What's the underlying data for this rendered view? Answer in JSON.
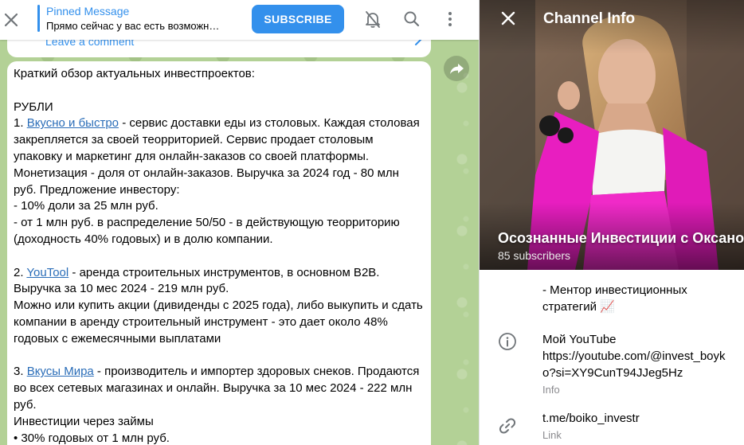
{
  "topbar": {
    "pinned_title": "Pinned Message",
    "pinned_text": "Прямо сейчас у вас есть возможн…",
    "subscribe_label": "SUBSCRIBE"
  },
  "comment": {
    "label": "Leave a comment"
  },
  "message": {
    "intro": "Краткий обзор актуальных инвестпроектов:",
    "section": "РУБЛИ",
    "items": [
      {
        "num": "1. ",
        "link": "Вкусно и быстро",
        "text": " - сервис доставки еды из столовых. Каждая столовая закрепляется за своей теорриторией. Сервис продает столовым упаковку и маркетинг для онлайн-заказов со своей платформы. Монетизация - доля от онлайн-заказов. Выручка за 2024 год - 80 млн руб. Предложение инвестору:",
        "extra": [
          "- 10% доли за 25 млн руб.",
          "- от 1 млн руб. в распределение 50/50 - в действующую теорриторию (доходность 40% годовых) и в долю компании."
        ]
      },
      {
        "num": "2. ",
        "link": "YouTool",
        "text": " - аренда строительных инструментов, в основном B2B. Выручка за 10 мес 2024 - 219 млн руб.",
        "extra": [
          "Можно или купить акции (дивиденды с 2025 года), либо выкупить и сдать компании в аренду строительный инструмент - это дает около 48% годовых с ежемесячными выплатами"
        ]
      },
      {
        "num": "3. ",
        "link": "Вкусы Мира",
        "text": " - производитель и импортер здоровых снеков. Продаются во всех сетевых магазинах и онлайн. Выручка за 10 мес 2024 - 222 млн руб.",
        "extra": [
          "Инвестиции через займы",
          "• 30% годовых от 1 млн руб."
        ]
      }
    ]
  },
  "info": {
    "title": "Channel Info",
    "channel_name": "Осознанные Инвестиции с Оксаной",
    "subscribers": "85 subscribers",
    "bio_line": "- Ментор инвестиционных стратегий 📈",
    "youtube_title": "Мой YouTube",
    "youtube_url": "https://youtube.com/@invest_boyko?si=XY9CunT94JJeg5Hz",
    "youtube_sub": "Info",
    "link_value": "t.me/boiko_investr",
    "link_sub": "Link"
  },
  "colors": {
    "accent": "#3390ec",
    "link": "#2a6db8",
    "chat_bg": "#b3d196",
    "cover_pink": "#e81ec0"
  },
  "icons": [
    "close-icon",
    "mute-bell-icon",
    "search-icon",
    "more-vertical-icon",
    "chevron-right-icon",
    "info-icon",
    "link-icon",
    "share-icon"
  ]
}
